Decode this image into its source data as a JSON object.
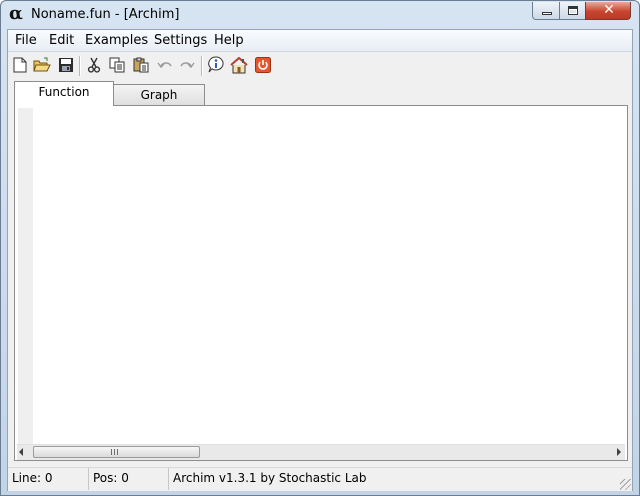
{
  "window": {
    "title": "Noname.fun - [Archim]",
    "app_icon_glyph": "α"
  },
  "menu": {
    "items": [
      "File",
      "Edit",
      "Examples",
      "Settings",
      "Help"
    ]
  },
  "toolbar": {
    "buttons": [
      "new-file-icon",
      "open-folder-icon",
      "save-icon",
      "cut-icon",
      "copy-icon",
      "paste-icon",
      "undo-icon",
      "redo-icon",
      "info-icon",
      "home-icon",
      "power-icon"
    ],
    "colors": {
      "folder": "#e9c45a",
      "info": "#2d5fb5",
      "home_roof": "#c0392b",
      "power": "#e4572e"
    }
  },
  "tabs": [
    {
      "label": "Function",
      "active": true
    },
    {
      "label": "Graph",
      "active": false
    }
  ],
  "editor": {
    "content": ""
  },
  "status": {
    "line": "Line: 0",
    "pos": "Pos: 0",
    "info": "Archim v1.3.1 by Stochastic Lab"
  }
}
